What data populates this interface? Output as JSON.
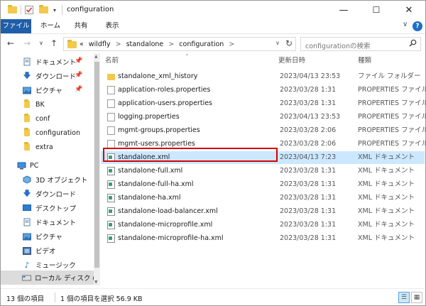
{
  "window": {
    "title": "configuration",
    "controls": {
      "minimize": "—",
      "maximize": "☐",
      "close": "✕"
    }
  },
  "ribbon": {
    "tabs": [
      "ファイル",
      "ホーム",
      "共有",
      "表示"
    ],
    "expand": "∨",
    "help": "?"
  },
  "address": {
    "prefix": "«",
    "crumbs": [
      "wildfly",
      "standalone",
      "configuration"
    ],
    "separator": ">",
    "dropdown": "∨",
    "refresh": "↻"
  },
  "search": {
    "placeholder": "configurationの検索",
    "icon": "search-icon"
  },
  "nav": {
    "back": "←",
    "forward": "→",
    "recent": "∨",
    "up": "↑",
    "items": [
      {
        "label": "ドキュメント",
        "icon": "documents-icon",
        "pinned": true
      },
      {
        "label": "ダウンロード",
        "icon": "download-icon",
        "pinned": true
      },
      {
        "label": "ピクチャ",
        "icon": "pictures-icon",
        "pinned": true
      },
      {
        "label": "BK",
        "icon": "folder-icon",
        "pinned": false
      },
      {
        "label": "conf",
        "icon": "folder-icon",
        "pinned": false
      },
      {
        "label": "configuration",
        "icon": "folder-icon",
        "pinned": false
      },
      {
        "label": "extra",
        "icon": "folder-icon",
        "pinned": false
      },
      {
        "label": "PC",
        "icon": "pc-icon",
        "pinned": false
      },
      {
        "label": "3D オブジェクト",
        "icon": "3d-objects-icon",
        "pinned": false
      },
      {
        "label": "ダウンロード",
        "icon": "download-icon",
        "pinned": false
      },
      {
        "label": "デスクトップ",
        "icon": "desktop-icon",
        "pinned": false
      },
      {
        "label": "ドキュメント",
        "icon": "documents-icon",
        "pinned": false
      },
      {
        "label": "ピクチャ",
        "icon": "pictures-icon",
        "pinned": false
      },
      {
        "label": "ビデオ",
        "icon": "videos-icon",
        "pinned": false
      },
      {
        "label": "ミュージック",
        "icon": "music-icon",
        "pinned": false
      },
      {
        "label": "ローカル ディスク (C",
        "icon": "drive-icon",
        "pinned": false
      }
    ]
  },
  "list": {
    "columns": {
      "name": "名前",
      "date": "更新日時",
      "kind": "種類"
    },
    "rows": [
      {
        "name": "standalone_xml_history",
        "date": "2023/04/13 23:53",
        "kind": "ファイル フォルダー",
        "icon": "folder"
      },
      {
        "name": "application-roles.properties",
        "date": "2023/03/28 1:31",
        "kind": "PROPERTIES ファイル",
        "icon": "file"
      },
      {
        "name": "application-users.properties",
        "date": "2023/03/28 1:31",
        "kind": "PROPERTIES ファイル",
        "icon": "file"
      },
      {
        "name": "logging.properties",
        "date": "2023/04/13 23:53",
        "kind": "PROPERTIES ファイル",
        "icon": "file"
      },
      {
        "name": "mgmt-groups.properties",
        "date": "2023/03/28 2:06",
        "kind": "PROPERTIES ファイル",
        "icon": "file"
      },
      {
        "name": "mgmt-users.properties",
        "date": "2023/03/28 2:06",
        "kind": "PROPERTIES ファイル",
        "icon": "file"
      },
      {
        "name": "standalone.xml",
        "date": "2023/04/13 7:23",
        "kind": "XML ドキュメント",
        "icon": "xml",
        "selected": true
      },
      {
        "name": "standalone-full.xml",
        "date": "2023/03/28 1:31",
        "kind": "XML ドキュメント",
        "icon": "xml"
      },
      {
        "name": "standalone-full-ha.xml",
        "date": "2023/03/28 1:31",
        "kind": "XML ドキュメント",
        "icon": "xml"
      },
      {
        "name": "standalone-ha.xml",
        "date": "2023/03/28 1:31",
        "kind": "XML ドキュメント",
        "icon": "xml"
      },
      {
        "name": "standalone-load-balancer.xml",
        "date": "2023/03/28 1:31",
        "kind": "XML ドキュメント",
        "icon": "xml"
      },
      {
        "name": "standalone-microprofile.xml",
        "date": "2023/03/28 1:31",
        "kind": "XML ドキュメント",
        "icon": "xml"
      },
      {
        "name": "standalone-microprofile-ha.xml",
        "date": "2023/03/28 1:31",
        "kind": "XML ドキュメント",
        "icon": "xml"
      }
    ]
  },
  "status": {
    "count": "13 個の項目",
    "selection": "1 個の項目を選択 56.9 KB"
  },
  "colors": {
    "accent": "#1f5ea8",
    "selection": "#cce8ff",
    "highlight_border": "#d60000",
    "folder": "#f2c94c"
  }
}
